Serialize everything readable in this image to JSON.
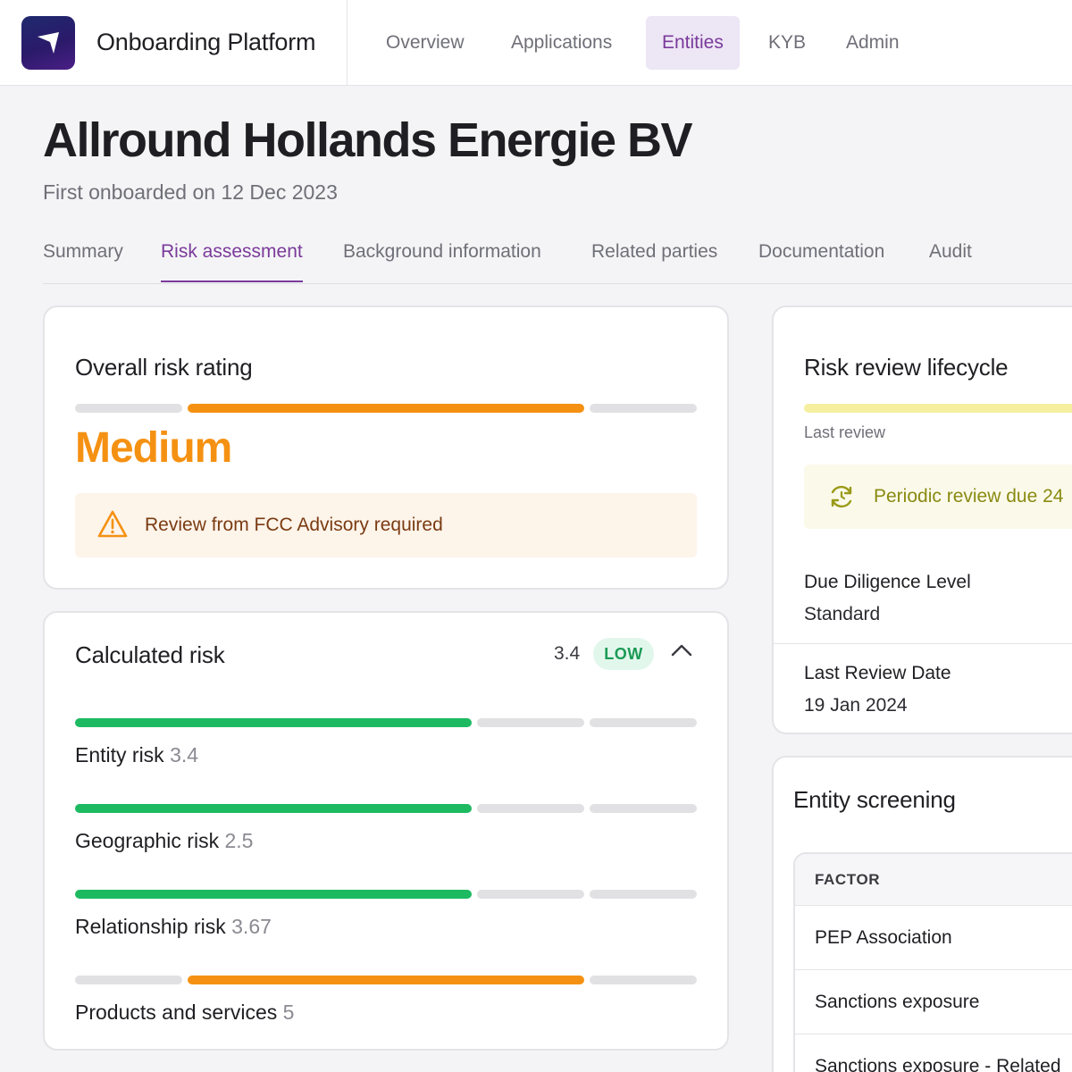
{
  "app": {
    "name": "Onboarding Platform"
  },
  "nav": {
    "items": [
      {
        "label": "Overview"
      },
      {
        "label": "Applications"
      },
      {
        "label": "Entities",
        "active": true
      },
      {
        "label": "KYB"
      },
      {
        "label": "Admin"
      }
    ]
  },
  "entity": {
    "name": "Allround Hollands Energie BV",
    "subtitle": "First onboarded on 12 Dec 2023"
  },
  "tabs": [
    {
      "label": "Summary"
    },
    {
      "label": "Risk assessment",
      "active": true
    },
    {
      "label": "Background information"
    },
    {
      "label": "Related parties"
    },
    {
      "label": "Documentation"
    },
    {
      "label": "Audit"
    }
  ],
  "overall_risk": {
    "title": "Overall risk rating",
    "level_index": 2,
    "level_count": 3,
    "value": "Medium",
    "color": "#f59112",
    "alert": {
      "icon": "warning-triangle-icon",
      "text": "Review from FCC Advisory required"
    }
  },
  "calculated_risk": {
    "title": "Calculated risk",
    "score": "3.4",
    "badge": "LOW",
    "collapse_icon": "chevron-up-icon",
    "items": [
      {
        "label": "Entity risk",
        "value": "3.4",
        "level": 2,
        "color": "green"
      },
      {
        "label": "Geographic risk",
        "value": "2.5",
        "level": 2,
        "color": "green"
      },
      {
        "label": "Relationship risk",
        "value": "3.67",
        "level": 2,
        "color": "green"
      },
      {
        "label": "Products and services",
        "value": "5",
        "level": "middle",
        "color": "orange"
      }
    ]
  },
  "lifecycle": {
    "title": "Risk review lifecycle",
    "last_review_label": "Last review",
    "review_notice": {
      "icon": "refresh-clock-icon",
      "text": "Periodic review due 24"
    },
    "fields": [
      {
        "label": "Due Diligence Level",
        "value": "Standard"
      },
      {
        "label": "Last Review Date",
        "value": "19 Jan 2024"
      }
    ]
  },
  "screening": {
    "title": "Entity screening",
    "header": "FACTOR",
    "rows": [
      {
        "factor": "PEP Association"
      },
      {
        "factor": "Sanctions exposure"
      },
      {
        "factor": "Sanctions exposure - Related"
      }
    ]
  },
  "colors": {
    "accent": "#7a3a9a",
    "medium": "#f59112",
    "low": "#1dba62",
    "track": "#e1e1e4"
  }
}
